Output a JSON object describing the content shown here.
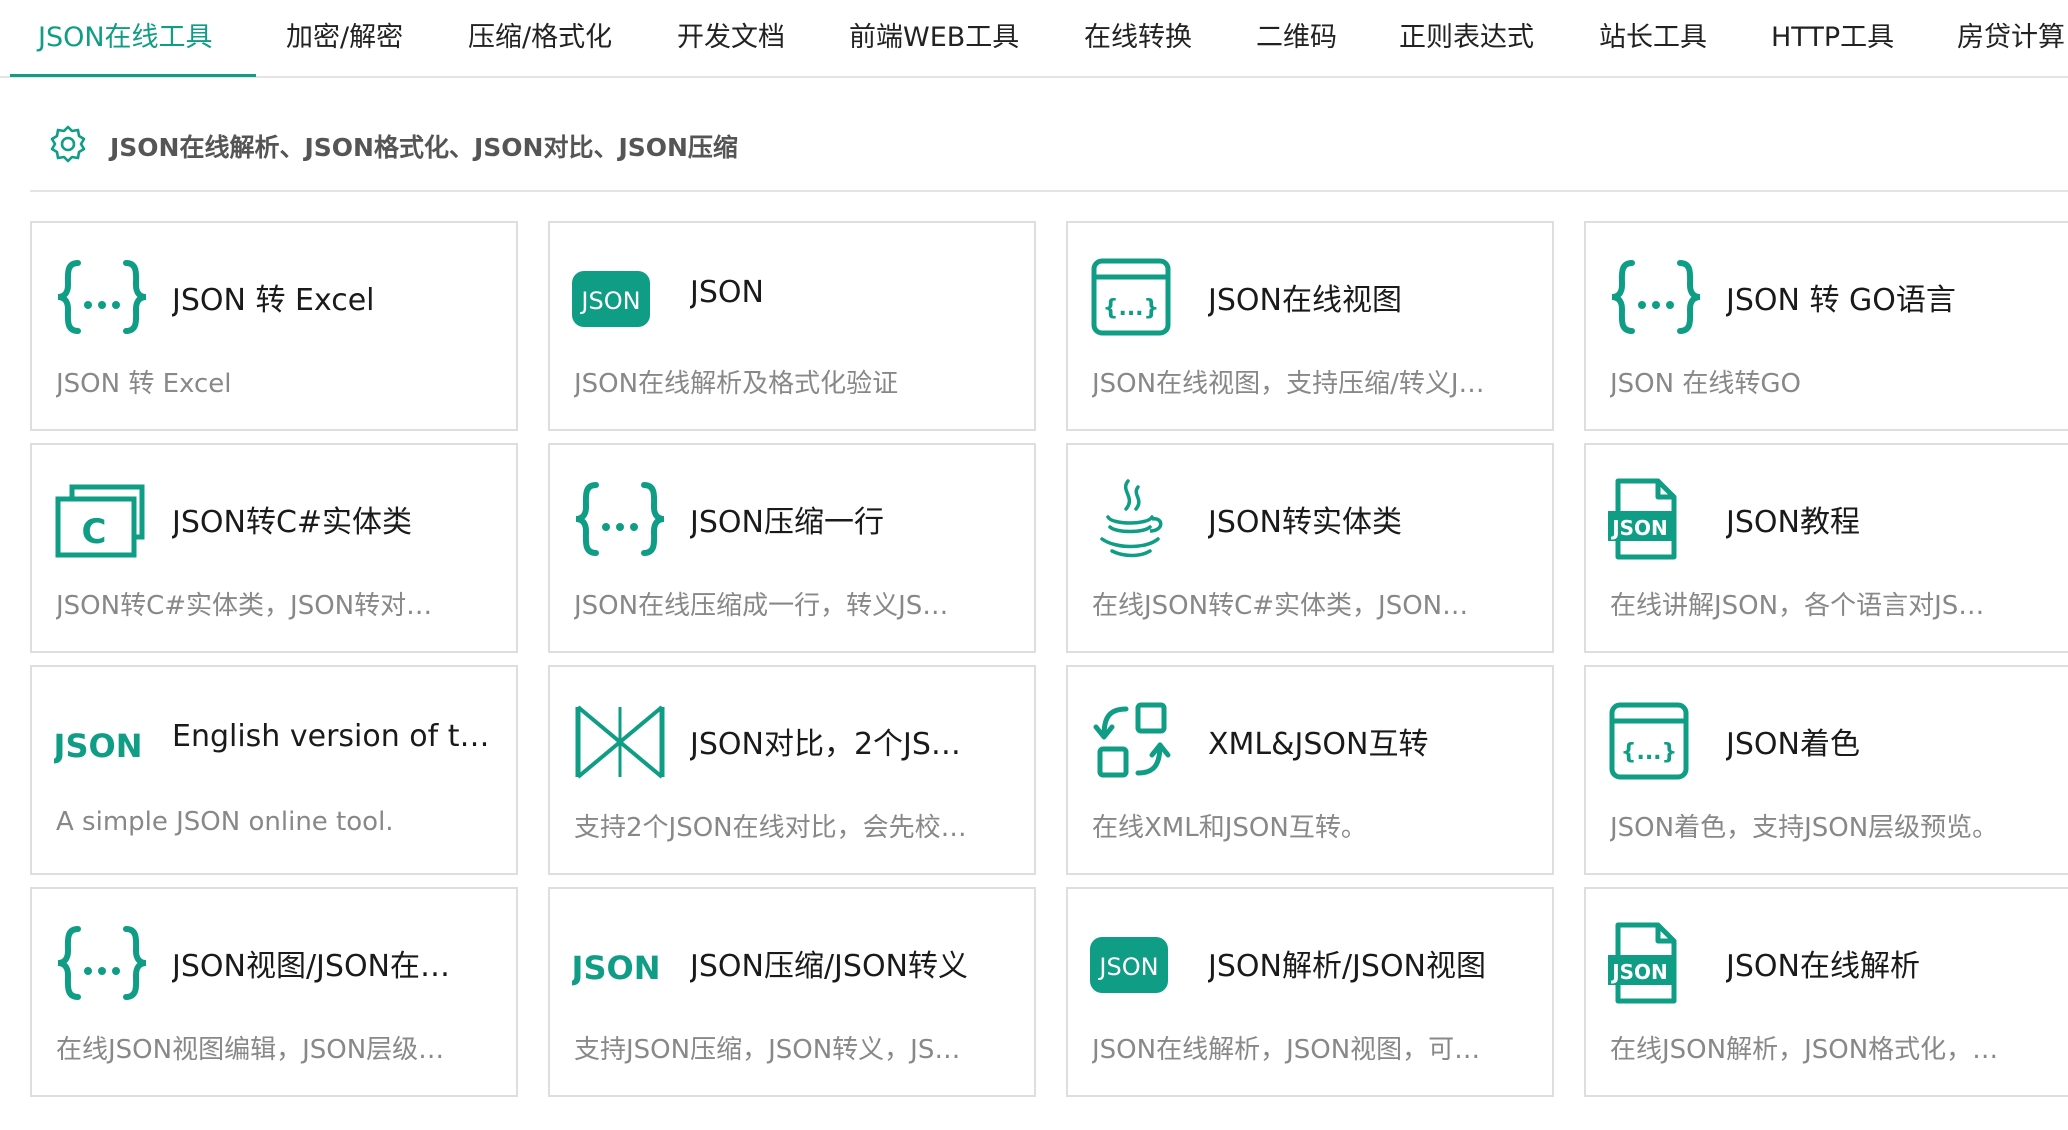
{
  "nav": {
    "tabs": [
      {
        "label": "JSON在线工具",
        "active": true
      },
      {
        "label": "加密/解密"
      },
      {
        "label": "压缩/格式化"
      },
      {
        "label": "开发文档"
      },
      {
        "label": "前端WEB工具"
      },
      {
        "label": "在线转换"
      },
      {
        "label": "二维码"
      },
      {
        "label": "正则表达式"
      },
      {
        "label": "站长工具"
      },
      {
        "label": "HTTP工具"
      },
      {
        "label": "房贷计算"
      }
    ]
  },
  "section": {
    "title": "JSON在线解析、JSON格式化、JSON对比、JSON压缩",
    "icon": "gear-icon"
  },
  "colors": {
    "accent": "#0f9d85",
    "border": "#dedede",
    "muted": "#888888"
  },
  "cards": [
    {
      "icon": "braces-icon",
      "title": "JSON 转 Excel",
      "desc": "JSON 转 Excel"
    },
    {
      "icon": "json-badge-icon",
      "badge": "JSON",
      "title": "JSON",
      "desc": "JSON在线解析及格式化验证"
    },
    {
      "icon": "json-window-icon",
      "glyph": "{...}",
      "title": "JSON在线视图",
      "desc": "JSON在线视图，支持压缩/转义J…"
    },
    {
      "icon": "braces-icon",
      "title": "JSON 转 GO语言",
      "desc": "JSON 在线转GO"
    },
    {
      "icon": "csharp-window-icon",
      "glyph": "C",
      "title": "JSON转C#实体类",
      "desc": "JSON转C#实体类，JSON转对…"
    },
    {
      "icon": "braces-icon",
      "title": "JSON压缩一行",
      "desc": "JSON在线压缩成一行，转义JS…"
    },
    {
      "icon": "java-cup-icon",
      "title": "JSON转实体类",
      "desc": "在线JSON转C#实体类，JSON…"
    },
    {
      "icon": "json-file-icon",
      "badge": "JSON",
      "title": "JSON教程",
      "desc": "在线讲解JSON，各个语言对JS…"
    },
    {
      "icon": "json-logo-icon",
      "badge": "JSON",
      "title": "English version of t…",
      "desc": "A simple JSON online tool."
    },
    {
      "icon": "compare-icon",
      "title": "JSON对比，2个JS…",
      "desc": "支持2个JSON在线对比，会先校…"
    },
    {
      "icon": "convert-icon",
      "title": "XML&JSON互转",
      "desc": "在线XML和JSON互转。"
    },
    {
      "icon": "json-window-icon",
      "glyph": "{...}",
      "title": "JSON着色",
      "desc": "JSON着色，支持JSON层级预览。"
    },
    {
      "icon": "braces-icon",
      "title": "JSON视图/JSON在…",
      "desc": "在线JSON视图编辑，JSON层级…"
    },
    {
      "icon": "json-logo-icon",
      "badge": "JSON",
      "title": "JSON压缩/JSON转义",
      "desc": "支持JSON压缩，JSON转义，JS…"
    },
    {
      "icon": "json-badge-icon",
      "badge": "JSON",
      "title": "JSON解析/JSON视图",
      "desc": "JSON在线解析，JSON视图，可…"
    },
    {
      "icon": "json-file-icon",
      "badge": "JSON",
      "title": "JSON在线解析",
      "desc": "在线JSON解析，JSON格式化，…"
    }
  ]
}
